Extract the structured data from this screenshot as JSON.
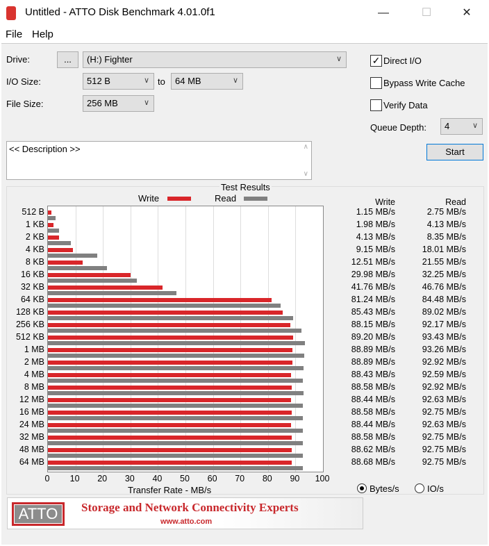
{
  "window": {
    "title": "Untitled - ATTO Disk Benchmark 4.01.0f1",
    "minimize": "—",
    "maximize": "☐",
    "close": "✕"
  },
  "menu": [
    "File",
    "Help"
  ],
  "drive": {
    "label": "Drive:",
    "browse": "...",
    "value": "(H:) Fighter"
  },
  "io_size": {
    "label": "I/O Size:",
    "from": "512 B",
    "to_label": "to",
    "to": "64 MB"
  },
  "file_size": {
    "label": "File Size:",
    "value": "256 MB"
  },
  "options": {
    "direct_io": {
      "label": "Direct I/O",
      "checked": true
    },
    "bypass_write_cache": {
      "label": "Bypass Write Cache",
      "checked": false
    },
    "verify_data": {
      "label": "Verify Data",
      "checked": false
    },
    "queue_depth_label": "Queue Depth:",
    "queue_depth": "4"
  },
  "description": "<< Description >>",
  "start_label": "Start",
  "results": {
    "title": "Test Results",
    "legend_write": "Write",
    "legend_read": "Read",
    "col_write": "Write",
    "col_read": "Read",
    "xlabel": "Transfer Rate - MB/s",
    "units_bytes": "Bytes/s",
    "units_io": "IO/s",
    "units_selected": "Bytes/s"
  },
  "colors": {
    "write": "#d9262a",
    "read": "#808080"
  },
  "chart_data": {
    "type": "bar",
    "orientation": "horizontal",
    "xlabel": "Transfer Rate - MB/s",
    "xlim": [
      0,
      100
    ],
    "xticks": [
      "0",
      "10",
      "20",
      "30",
      "40",
      "50",
      "60",
      "70",
      "80",
      "90",
      "100"
    ],
    "categories": [
      "512 B",
      "1 KB",
      "2 KB",
      "4 KB",
      "8 KB",
      "16 KB",
      "32 KB",
      "64 KB",
      "128 KB",
      "256 KB",
      "512 KB",
      "1 MB",
      "2 MB",
      "4 MB",
      "8 MB",
      "12 MB",
      "16 MB",
      "24 MB",
      "32 MB",
      "48 MB",
      "64 MB"
    ],
    "series": [
      {
        "name": "Write",
        "values": [
          1.15,
          1.98,
          4.13,
          9.15,
          12.51,
          29.98,
          41.76,
          81.24,
          85.43,
          88.15,
          89.2,
          88.89,
          88.89,
          88.43,
          88.58,
          88.44,
          88.58,
          88.44,
          88.58,
          88.62,
          88.68
        ],
        "labels": [
          "1.15 MB/s",
          "1.98 MB/s",
          "4.13 MB/s",
          "9.15 MB/s",
          "12.51 MB/s",
          "29.98 MB/s",
          "41.76 MB/s",
          "81.24 MB/s",
          "85.43 MB/s",
          "88.15 MB/s",
          "89.20 MB/s",
          "88.89 MB/s",
          "88.89 MB/s",
          "88.43 MB/s",
          "88.58 MB/s",
          "88.44 MB/s",
          "88.58 MB/s",
          "88.44 MB/s",
          "88.58 MB/s",
          "88.62 MB/s",
          "88.68 MB/s"
        ]
      },
      {
        "name": "Read",
        "values": [
          2.75,
          4.13,
          8.35,
          18.01,
          21.55,
          32.25,
          46.76,
          84.48,
          89.02,
          92.17,
          93.43,
          93.26,
          92.92,
          92.59,
          92.92,
          92.63,
          92.75,
          92.63,
          92.75,
          92.75,
          92.75
        ],
        "labels": [
          "2.75 MB/s",
          "4.13 MB/s",
          "8.35 MB/s",
          "18.01 MB/s",
          "21.55 MB/s",
          "32.25 MB/s",
          "46.76 MB/s",
          "84.48 MB/s",
          "89.02 MB/s",
          "92.17 MB/s",
          "93.43 MB/s",
          "93.26 MB/s",
          "92.92 MB/s",
          "92.59 MB/s",
          "92.92 MB/s",
          "92.63 MB/s",
          "92.75 MB/s",
          "92.63 MB/s",
          "92.75 MB/s",
          "92.75 MB/s",
          "92.75 MB/s"
        ]
      }
    ]
  },
  "banner": {
    "logo": "ATTO",
    "tagline": "Storage and Network Connectivity Experts",
    "url": "www.atto.com"
  }
}
